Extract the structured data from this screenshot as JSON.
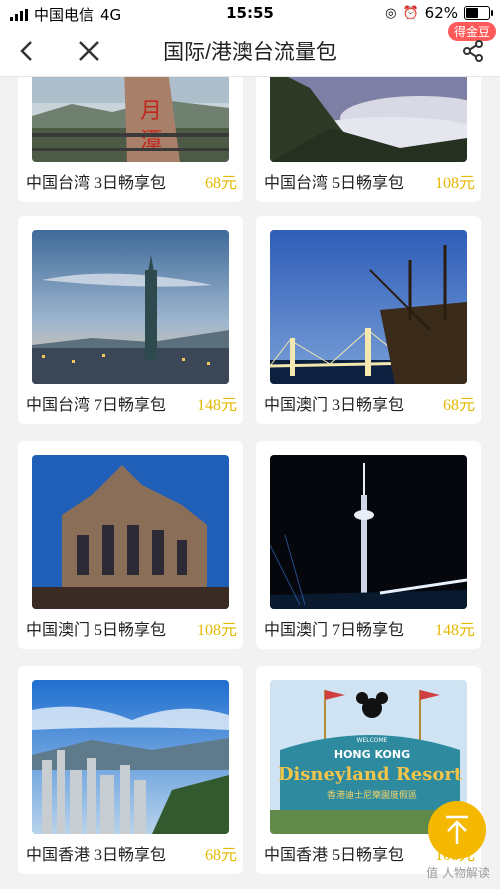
{
  "status": {
    "carrier": "中国电信",
    "network": "4G",
    "time": "15:55",
    "battery": "62%",
    "battery_level": 0.62
  },
  "nav": {
    "title": "国际/港澳台流量包",
    "badge": "得金豆"
  },
  "products": [
    {
      "name": "中国台湾 3日畅享包",
      "price": "68元",
      "scene": "taiwan-sun-moon-lake"
    },
    {
      "name": "中国台湾 5日畅享包",
      "price": "108元",
      "scene": "taiwan-mountain-sea"
    },
    {
      "name": "中国台湾 7日畅享包",
      "price": "148元",
      "scene": "taipei-101"
    },
    {
      "name": "中国澳门 3日畅享包",
      "price": "68元",
      "scene": "macau-bridge-ship"
    },
    {
      "name": "中国澳门 5日畅享包",
      "price": "108元",
      "scene": "ruins-of-st-paul"
    },
    {
      "name": "中国澳门 7日畅享包",
      "price": "148元",
      "scene": "macau-tower-night"
    },
    {
      "name": "中国香港 3日畅享包",
      "price": "68元",
      "scene": "hong-kong-skyline"
    },
    {
      "name": "中国香港 5日畅享包",
      "price": "108元",
      "scene": "hong-kong-disneyland"
    }
  ],
  "disney": {
    "welcome": "WELCOME",
    "hong_kong": "HONG KONG",
    "disneyland": "Disneyland Resort",
    "cn": "香港迪士尼樂園度假區"
  },
  "watermark": "值 人物解读",
  "colors": {
    "price": "#e4b800",
    "accent": "#f5b800",
    "badge": "#ff5a5a"
  }
}
